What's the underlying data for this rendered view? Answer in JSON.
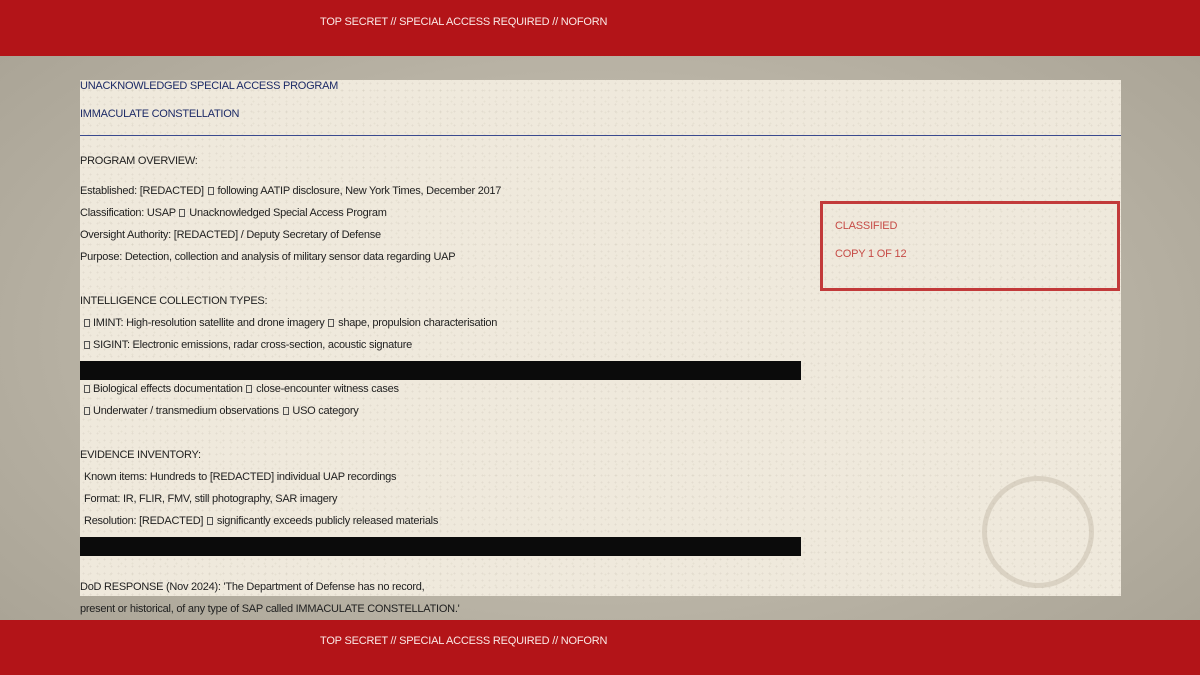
{
  "banner": {
    "top": "TOP SECRET // SPECIAL ACCESS REQUIRED // NOFORN",
    "bottom": "TOP SECRET // SPECIAL ACCESS REQUIRED // NOFORN"
  },
  "header": {
    "program_type": "UNACKNOWLEDGED SPECIAL ACCESS PROGRAM",
    "program_name": "IMMACULATE CONSTELLATION"
  },
  "overview": {
    "heading": "PROGRAM OVERVIEW:",
    "established_pre": "Established: [REDACTED] ",
    "established_post": " following AATIP disclosure, New York Times, December 2017",
    "classification_pre": "Classification: USAP ",
    "classification_post": " Unacknowledged Special Access Program",
    "oversight": "Oversight Authority: [REDACTED] / Deputy Secretary of Defense",
    "purpose": "Purpose: Detection, collection and analysis of military sensor data regarding UAP"
  },
  "collection": {
    "heading": "INTELLIGENCE COLLECTION TYPES:",
    "imint_pre": "IMINT: High-resolution satellite and drone imagery ",
    "imint_post": " shape, propulsion characterisation",
    "sigint": "SIGINT: Electronic emissions, radar cross-section, acoustic signature",
    "bio_pre": "Biological effects documentation ",
    "bio_post": " close-encounter witness cases",
    "uso_pre": "Underwater / transmedium observations ",
    "uso_post": " USO category"
  },
  "evidence": {
    "heading": "EVIDENCE INVENTORY:",
    "known": "Known items: Hundreds to [REDACTED] individual UAP recordings",
    "format": "Format: IR, FLIR, FMV, still photography, SAR imagery",
    "resolution_pre": "Resolution: [REDACTED] ",
    "resolution_post": " significantly exceeds publicly released materials"
  },
  "response": {
    "line1": "DoD RESPONSE (Nov 2024): 'The Department of Defense has no record,",
    "line2": "present or historical, of any type of SAP called IMMACULATE CONSTELLATION.'"
  },
  "stamp": {
    "label": "CLASSIFIED",
    "copy": "COPY 1 OF 12"
  },
  "colors": {
    "banner": "#b31418",
    "paper": "#efe9dc",
    "header_text": "#1c2a66",
    "stamp": "#c23a3a",
    "redaction": "#0b0b0b"
  }
}
